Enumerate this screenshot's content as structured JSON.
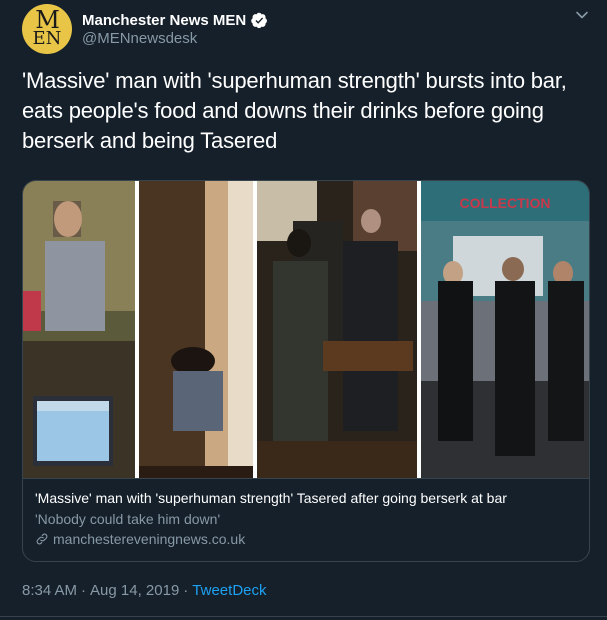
{
  "account": {
    "display_name": "Manchester News MEN",
    "handle": "@MENnewsdesk",
    "avatar_text_top": "M",
    "avatar_text_bottom": "EN",
    "avatar_color": "#e8c547",
    "verified": true
  },
  "tweet": {
    "text": "'Massive' man with 'superhuman strength' bursts into bar, eats people's food and downs their drinks before going berserk and being Tasered"
  },
  "card": {
    "title": "'Massive' man with 'superhuman strength' Tasered after going berserk at bar",
    "description": "'Nobody could take him down'",
    "domain": "manchestereveningnews.co.uk",
    "image_sign_text": "COLLECTION"
  },
  "meta": {
    "time": "8:34 AM",
    "separator": "·",
    "date": "Aug 14, 2019",
    "separator2": "·",
    "source": "TweetDeck"
  },
  "colors": {
    "background": "#15202b",
    "secondary_text": "#8899a6",
    "link": "#1da1f2",
    "border": "#38444d",
    "verified": "#ffffff"
  },
  "icons": [
    "verified-badge-icon",
    "chevron-down-icon",
    "link-icon"
  ]
}
